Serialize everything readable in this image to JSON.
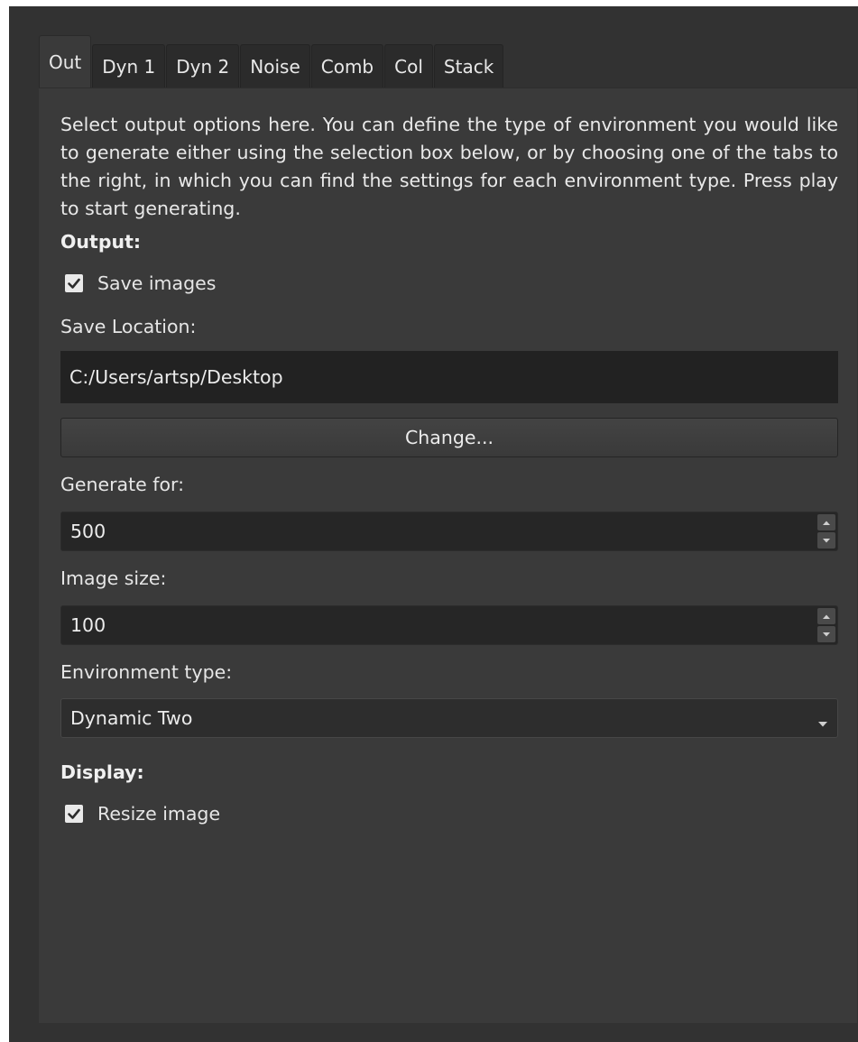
{
  "tabs": [
    {
      "label": "Out",
      "active": true
    },
    {
      "label": "Dyn 1",
      "active": false
    },
    {
      "label": "Dyn 2",
      "active": false
    },
    {
      "label": "Noise",
      "active": false
    },
    {
      "label": "Comb",
      "active": false
    },
    {
      "label": "Col",
      "active": false
    },
    {
      "label": "Stack",
      "active": false
    }
  ],
  "description": "Select output options here. You can define the type of environment you would like to generate either using the selection box below, or by choosing one of the tabs to the right, in which you can find the settings for each environment type. Press play to start generating.",
  "output": {
    "heading": "Output:",
    "save_images_label": "Save images",
    "save_images_checked": true,
    "save_location_label": "Save Location:",
    "save_location_value": "C:/Users/artsp/Desktop",
    "change_button": "Change...",
    "generate_for_label": "Generate for:",
    "generate_for_value": "500",
    "image_size_label": "Image size:",
    "image_size_value": "100",
    "environment_type_label": "Environment type:",
    "environment_type_value": "Dynamic Two"
  },
  "display": {
    "heading": "Display:",
    "resize_image_label": "Resize image",
    "resize_image_checked": true
  },
  "icons": {
    "checkbox_check": "check-icon",
    "spin_up": "arrow-up-icon",
    "spin_down": "arrow-down-icon",
    "dropdown": "chevron-down-icon"
  },
  "colors": {
    "window_bg": "#323232",
    "panel_bg": "#3a3a3a",
    "field_bg": "#222222",
    "text": "#e6e6e6"
  }
}
